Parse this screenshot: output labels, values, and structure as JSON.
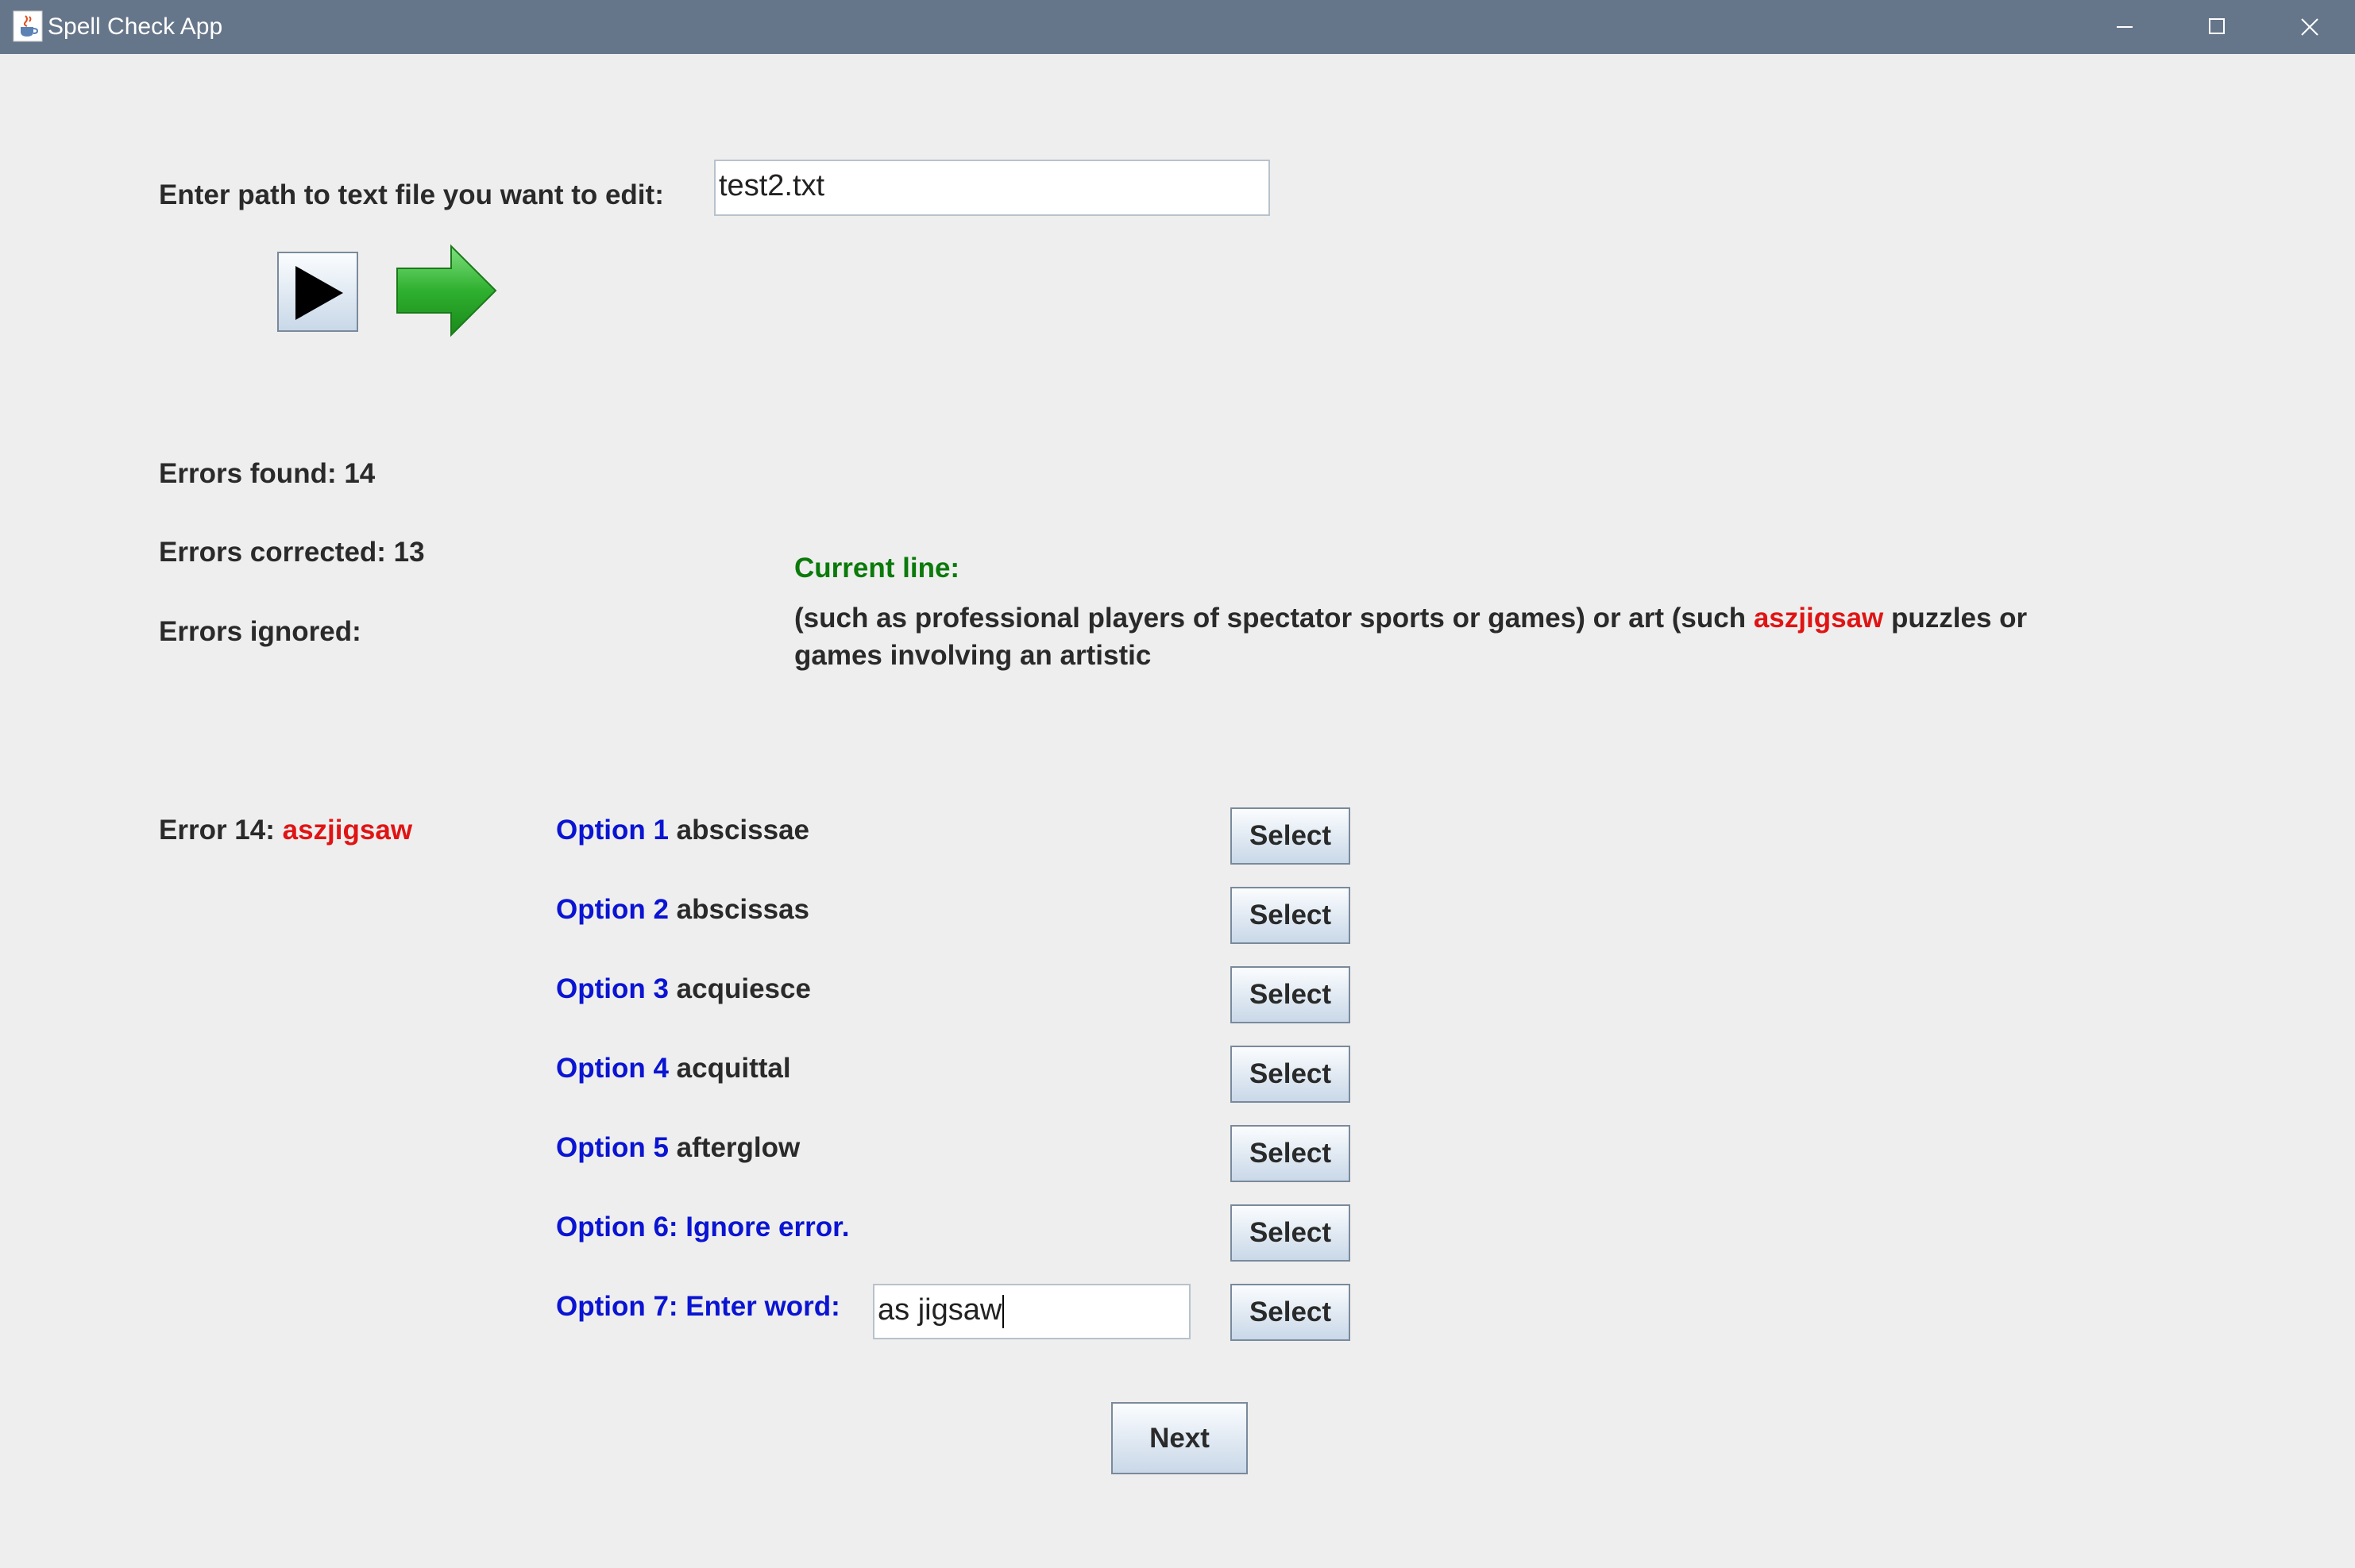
{
  "window": {
    "title": "Spell Check App",
    "icon": "java-cup-icon",
    "controls": [
      "minimize-icon",
      "maximize-icon",
      "close-icon"
    ]
  },
  "file": {
    "prompt": "Enter path to text file you want to edit:",
    "path_value": "test2.txt"
  },
  "toolbar": {
    "run_icon": "play-icon",
    "forward_icon": "green-arrow-right-icon"
  },
  "stats": {
    "errors_found": "Errors found: 14",
    "errors_corrected": "Errors corrected: 13",
    "errors_ignored": "Errors ignored:"
  },
  "current_line": {
    "heading": "Current line:",
    "text_before": "(such as professional players of spectator sports or games) or art (such ",
    "error_word": "aszjigsaw",
    "text_after": " puzzles or games involving an artistic"
  },
  "error": {
    "label": "Error 14: ",
    "word": "aszjigsaw"
  },
  "options": [
    {
      "label": "Option 1",
      "word": " abscissae",
      "button": "Select"
    },
    {
      "label": "Option 2",
      "word": " abscissas",
      "button": "Select"
    },
    {
      "label": "Option 3",
      "word": " acquiesce",
      "button": "Select"
    },
    {
      "label": "Option 4",
      "word": " acquittal",
      "button": "Select"
    },
    {
      "label": "Option 5",
      "word": " afterglow",
      "button": "Select"
    },
    {
      "label": "Option 6: Ignore error.",
      "word": "",
      "button": "Select"
    },
    {
      "label": "Option 7: Enter word:",
      "word": "",
      "button": "Select"
    }
  ],
  "custom_word": {
    "value": "as jigsaw"
  },
  "next_button": "Next",
  "colors": {
    "titlebar": "#66768a",
    "option_blue": "#0a14d2",
    "error_red": "#e01414",
    "heading_green": "#0a7a0a",
    "background": "#eeeeee"
  }
}
